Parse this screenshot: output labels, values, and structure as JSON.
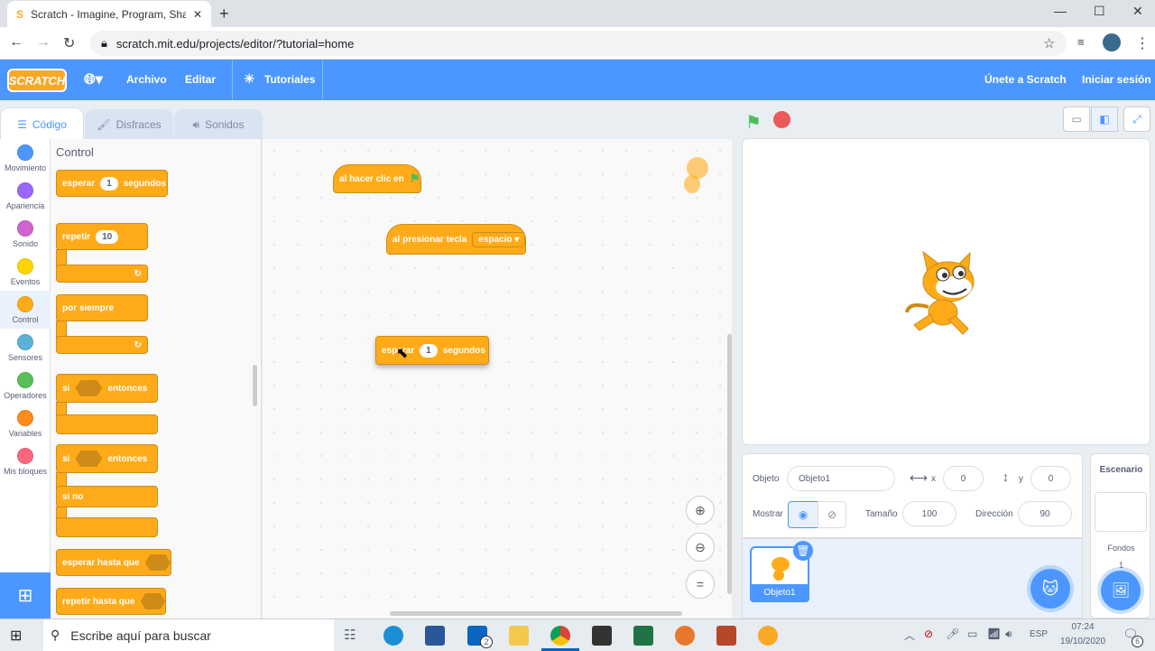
{
  "browser": {
    "tab_title": "Scratch - Imagine, Program, Shar",
    "url": "scratch.mit.edu/projects/editor/?tutorial=home"
  },
  "menu": {
    "logo": "SCRATCH",
    "archivo": "Archivo",
    "editar": "Editar",
    "tutoriales": "Tutoriales",
    "join": "Únete a Scratch",
    "signin": "Iniciar sesión"
  },
  "tabs": {
    "code": "Código",
    "costumes": "Disfraces",
    "sounds": "Sonidos"
  },
  "categories": [
    {
      "label": "Movimiento",
      "color": "#4c97ff"
    },
    {
      "label": "Apariencia",
      "color": "#9966ff"
    },
    {
      "label": "Sonido",
      "color": "#cf63cf"
    },
    {
      "label": "Eventos",
      "color": "#ffd500"
    },
    {
      "label": "Control",
      "color": "#ffab19"
    },
    {
      "label": "Sensores",
      "color": "#5cb1d6"
    },
    {
      "label": "Operadores",
      "color": "#59c059"
    },
    {
      "label": "Variables",
      "color": "#ff8c1a"
    },
    {
      "label": "Mis bloques",
      "color": "#ff6680"
    }
  ],
  "palette": {
    "heading": "Control",
    "wait": {
      "a": "esperar",
      "v": "1",
      "b": "segundos"
    },
    "repeat": {
      "a": "repetir",
      "v": "10"
    },
    "forever": "por siempre",
    "if1": {
      "a": "si",
      "b": "entonces"
    },
    "if2": {
      "a": "si",
      "b": "entonces",
      "c": "si no"
    },
    "wait_until": "esperar hasta que",
    "repeat_until": "repetir hasta que"
  },
  "workspace": {
    "flag_block": "al hacer clic en",
    "key_block": {
      "a": "al presionar tecla",
      "key": "espacio"
    },
    "wait_block": {
      "a": "esperar",
      "v": "1",
      "b": "segundos"
    }
  },
  "sprite_info": {
    "objeto_label": "Objeto",
    "objeto_value": "Objeto1",
    "x_label": "x",
    "x_value": "0",
    "y_label": "y",
    "y_value": "0",
    "mostrar": "Mostrar",
    "tamano_label": "Tamaño",
    "tamano_value": "100",
    "direccion_label": "Dirección",
    "direccion_value": "90",
    "sprite_name": "Objeto1"
  },
  "stage_panel": {
    "title": "Escenario",
    "fondos": "Fondos",
    "count": "1"
  },
  "taskbar": {
    "search": "Escribe aquí para buscar",
    "lang": "ESP",
    "time": "07:24",
    "date": "19/10/2020",
    "notif": "6",
    "mail_badge": "2"
  },
  "colors": {
    "scratch_blue": "#4c97ff",
    "control_orange": "#ffab19"
  }
}
